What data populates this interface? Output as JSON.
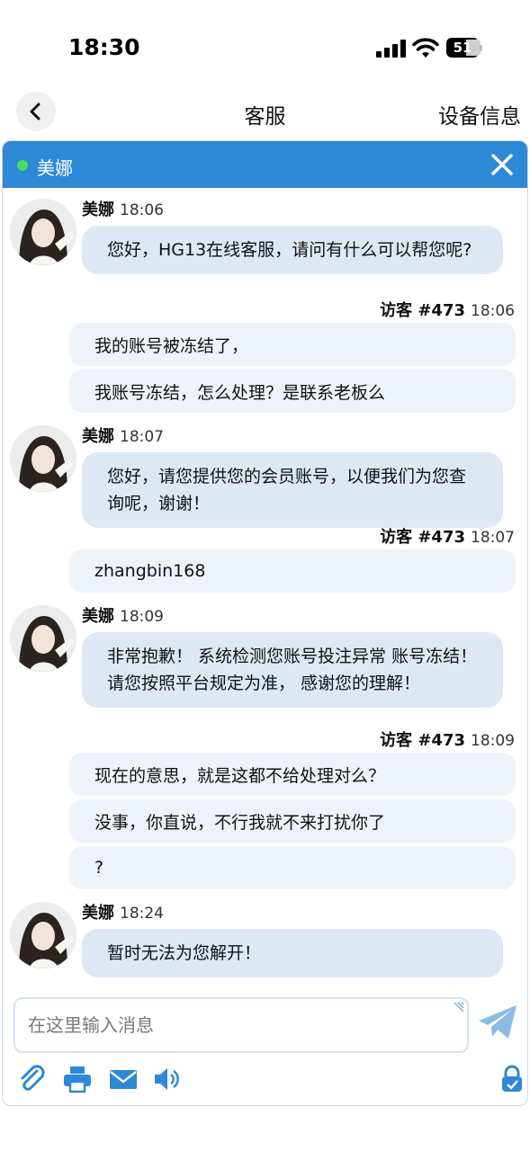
{
  "status_bar": {
    "time": "18:30",
    "battery": "51"
  },
  "nav": {
    "title": "客服",
    "right_action": "设备信息"
  },
  "chat_header": {
    "agent_name": "美娜"
  },
  "messages": {
    "m1": {
      "sender": "美娜",
      "time": "18:06",
      "text": "您好，HG13在线客服，请问有什么可以帮您呢?"
    },
    "m2": {
      "sender": "访客 #473",
      "time": "18:06",
      "lines": [
        "我的账号被冻结了，",
        "我账号冻结，怎么处理？是联系老板么"
      ]
    },
    "m3": {
      "sender": "美娜",
      "time": "18:07",
      "text": "您好，请您提供您的会员账号，以便我们为您查询呢，谢谢！"
    },
    "m4": {
      "sender": "访客 #473",
      "time": "18:07",
      "lines": [
        "zhangbin168"
      ]
    },
    "m5": {
      "sender": "美娜",
      "time": "18:09",
      "text": "非常抱歉！ 系统检测您账号投注异常 账号冻结！ 请您按照平台规定为准， 感谢您的理解！"
    },
    "m6": {
      "sender": "访客 #473",
      "time": "18:09",
      "lines": [
        "现在的意思，就是这都不给处理对么？",
        "没事，你直说，不行我就不来打扰你了",
        "?"
      ]
    },
    "m7": {
      "sender": "美娜",
      "time": "18:24",
      "text": "暂时无法为您解开！"
    }
  },
  "composer": {
    "placeholder": "在这里输入消息"
  },
  "icons": {
    "accent": "#2d88d6",
    "toolbar": [
      "paperclip-icon",
      "printer-icon",
      "mail-icon",
      "speaker-icon",
      "lock-icon"
    ],
    "send": "paper-plane-icon"
  }
}
